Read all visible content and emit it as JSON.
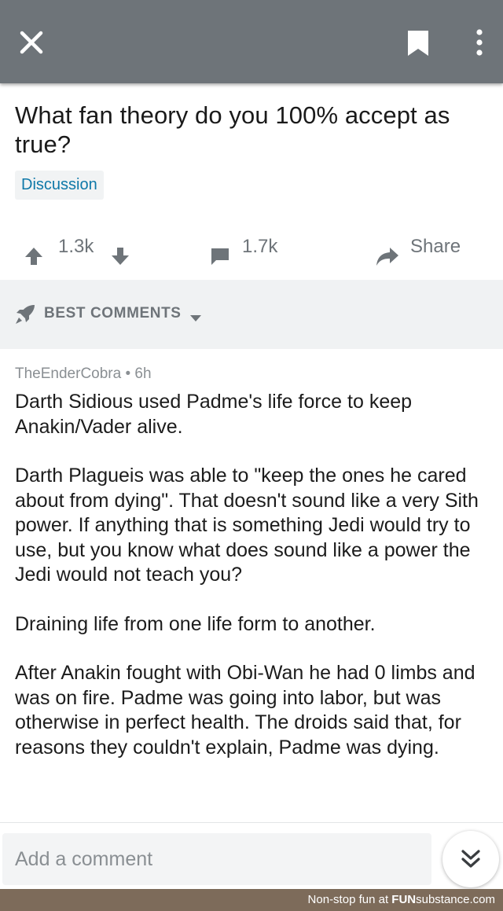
{
  "topbar": {
    "close_icon": "close-icon",
    "bookmark_icon": "bookmark-icon",
    "more_icon": "more-vertical-icon",
    "background": "#6e7479"
  },
  "post": {
    "title": "What fan theory do you 100% accept as true?",
    "flair": "Discussion",
    "votes": "1.3k",
    "comments": "1.7k",
    "share_label": "Share"
  },
  "sort": {
    "label": "BEST COMMENTS",
    "icon": "rocket-icon"
  },
  "comment": {
    "author": "TheEnderCobra",
    "age": "6h",
    "separator": "•",
    "paragraphs": [
      "Darth Sidious used Padme's life force to keep Anakin/Vader alive.",
      "Darth Plagueis was able to \"keep the ones he cared about from dying\". That doesn't sound like a very Sith power. If anything that is something Jedi would try to use, but you know what does sound like a power the Jedi would not teach you?",
      "Draining life from one life form to another.",
      "After Anakin fought with Obi-Wan he had 0 limbs and was on fire. Padme was going into labor, but was otherwise in perfect health. The droids said that, for reasons they couldn't explain, Padme was dying."
    ]
  },
  "composer": {
    "placeholder": "Add a comment",
    "scroll_icon": "double-chevron-down-icon"
  },
  "watermark": {
    "prefix": "Non-stop fun at",
    "brand_bold": "FUN",
    "brand_rest": "substance.com",
    "background": "#7d6b5a"
  },
  "colors": {
    "flair_text": "#0e78a8",
    "muted": "#6e7479"
  }
}
